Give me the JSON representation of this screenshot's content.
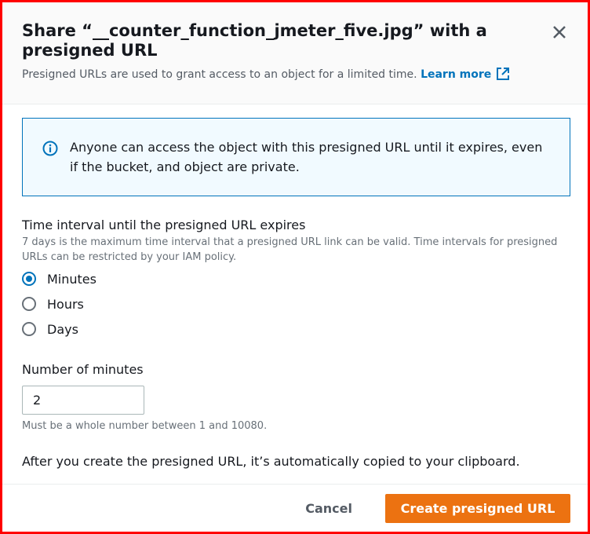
{
  "modal": {
    "title": "Share “__counter_function_jmeter_five.jpg” with a presigned URL",
    "subtitle": "Presigned URLs are used to grant access to an object for a limited time.",
    "learn_more": "Learn more",
    "close_icon": "close-icon"
  },
  "alert": {
    "icon": "info-icon",
    "text": "Anyone can access the object with this presigned URL until it expires, even if the bucket, and object are private."
  },
  "interval": {
    "label": "Time interval until the presigned URL expires",
    "description": "7 days is the maximum time interval that a presigned URL link can be valid. Time intervals for presigned URLs can be restricted by your IAM policy.",
    "options": [
      {
        "label": "Minutes",
        "selected": true
      },
      {
        "label": "Hours",
        "selected": false
      },
      {
        "label": "Days",
        "selected": false
      }
    ]
  },
  "minutes": {
    "label": "Number of minutes",
    "value": "2",
    "constraint": "Must be a whole number between 1 and 10080."
  },
  "clipboard_note": "After you create the presigned URL, it’s automatically copied to your clipboard.",
  "footer": {
    "cancel": "Cancel",
    "create": "Create presigned URL"
  },
  "colors": {
    "accent": "#0073bb",
    "primary_button": "#ec7211",
    "frame_border": "#ff0000"
  }
}
